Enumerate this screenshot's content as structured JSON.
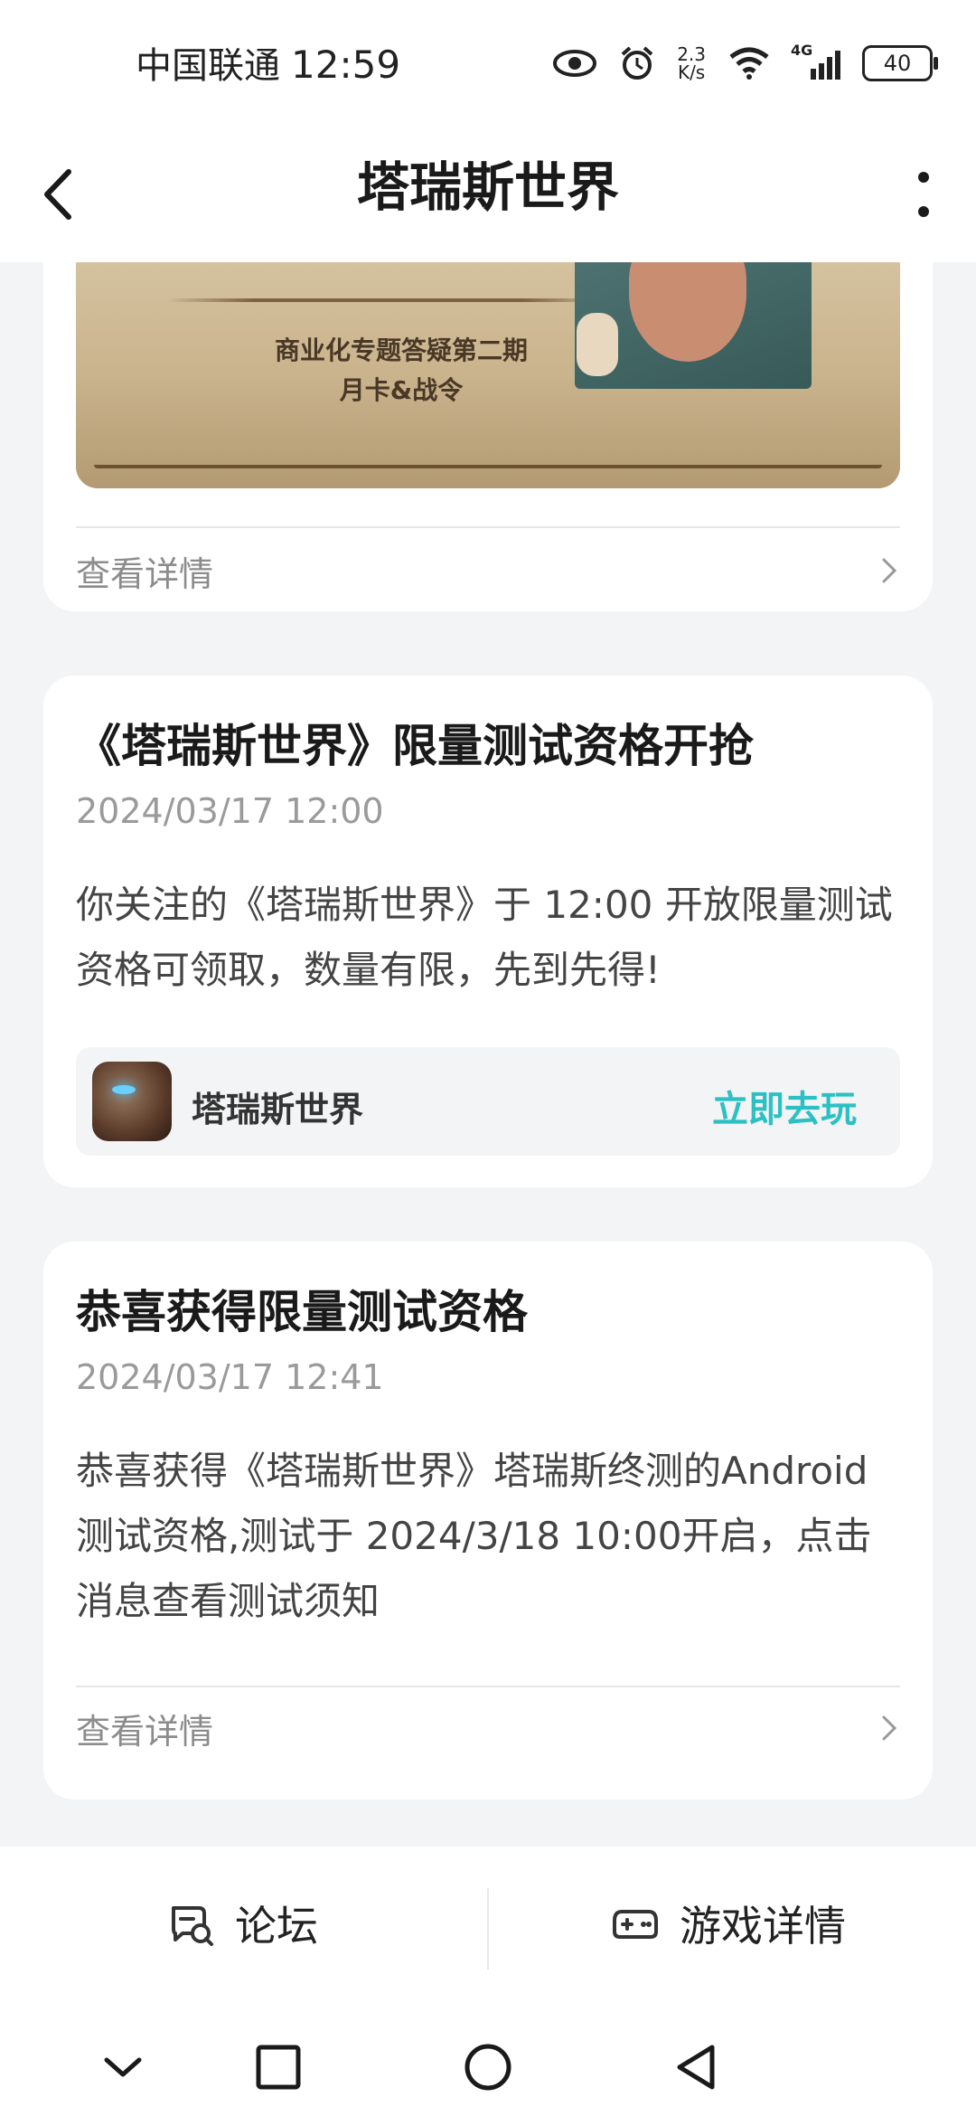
{
  "status_bar": {
    "carrier": "中国联通",
    "time": "12:59",
    "net_speed_value": "2.3",
    "net_speed_unit": "K/s",
    "network_type": "4G",
    "battery": "40"
  },
  "header": {
    "title": "塔瑞斯世界"
  },
  "cards": [
    {
      "banner_line1": "商业化专题答疑第二期",
      "banner_line2": "月卡&战令",
      "detail_label": "查看详情"
    },
    {
      "title": "《塔瑞斯世界》限量测试资格开抢",
      "time": "2024/03/17 12:00",
      "body": "你关注的《塔瑞斯世界》于 12:00 开放限量测试资格可领取，数量有限，先到先得!",
      "game_name": "塔瑞斯世界",
      "play_label": "立即去玩"
    },
    {
      "title": "恭喜获得限量测试资格",
      "time": "2024/03/17 12:41",
      "body": "恭喜获得《塔瑞斯世界》塔瑞斯终测的Android测试资格,测试于 2024/3/18 10:00开启，点击消息查看测试须知",
      "detail_label": "查看详情"
    }
  ],
  "bottom_tabs": {
    "forum": "论坛",
    "game_details": "游戏详情"
  },
  "colors": {
    "accent": "#2cc0c4",
    "background": "#f3f4f6",
    "card": "#ffffff"
  }
}
